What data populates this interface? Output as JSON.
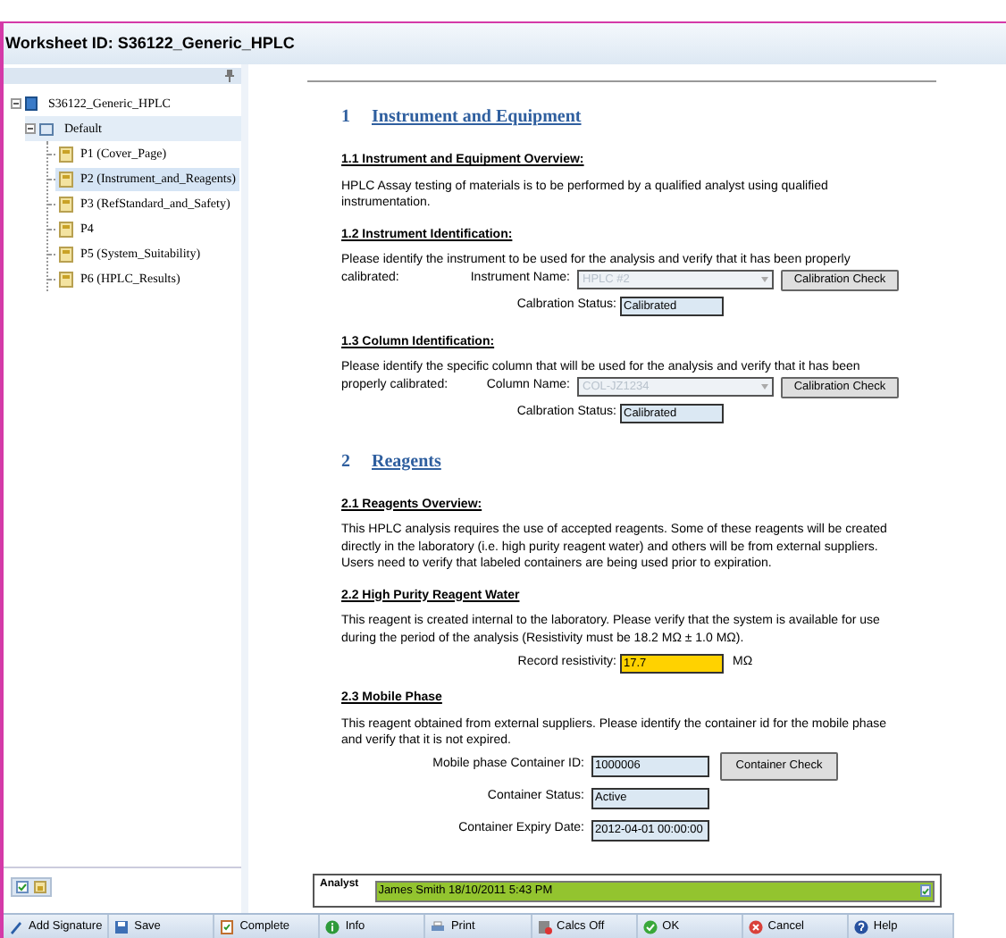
{
  "title": "Worksheet ID: S36122_Generic_HPLC",
  "tree": {
    "label": "S36122_Generic_HPLC",
    "expanded": true,
    "children": [
      {
        "label": "Default",
        "expanded": true,
        "children": [
          {
            "label": "P1 (Cover_Page)",
            "selected": false
          },
          {
            "label": "P2 (Instrument_and_Reagents)",
            "selected": true
          },
          {
            "label": "P3 (RefStandard_and_Safety)",
            "selected": false
          },
          {
            "label": "P4",
            "selected": false
          },
          {
            "label": "P5 (System_Suitability)",
            "selected": false
          },
          {
            "label": "P6 (HPLC_Results)",
            "selected": false
          }
        ]
      }
    ]
  },
  "content": [
    {
      "kind": "heading",
      "number": "1",
      "text": "Instrument and Equipment"
    },
    {
      "kind": "subheading",
      "text": "1.1 Instrument and Equipment Overview:"
    },
    {
      "kind": "paragraph",
      "text": "HPLC Assay testing of materials is to be performed by a qualified analyst using qualified instrumentation."
    },
    {
      "kind": "subheading",
      "text": "1.2 Instrument Identification:"
    },
    {
      "kind": "paragraph",
      "text": "Please identify the instrument to be used for the analysis and verify that it has been properly"
    },
    {
      "kind": "select",
      "lead": "calibrated:",
      "label": "Instrument Name:",
      "value": "HPLC #2",
      "disabled": true,
      "button": "Calibration Check"
    },
    {
      "kind": "field",
      "label": "Calbration Status:",
      "value": "Calibrated",
      "highlight": false
    },
    {
      "kind": "subheading",
      "text": "1.3 Column Identification:"
    },
    {
      "kind": "paragraph",
      "text": "Please identify the specific column that will be used for the analysis and verify that it has been"
    },
    {
      "kind": "select",
      "lead": "properly calibrated:",
      "label": "Column Name:",
      "value": "COL-JZ1234",
      "disabled": true,
      "button": "Calibration Check"
    },
    {
      "kind": "field",
      "label": "Calbration Status:",
      "value": "Calibrated",
      "highlight": false
    },
    {
      "kind": "heading",
      "number": "2",
      "text": "Reagents"
    },
    {
      "kind": "subheading",
      "text": "2.1 Reagents Overview:"
    },
    {
      "kind": "paragraph",
      "text": "This HPLC analysis requires the use of accepted reagents.  Some of these reagents will be created directly in the laboratory (i.e. high purity reagent water) and others will be from external suppliers.  Users need to verify that labeled containers are being used prior to expiration."
    },
    {
      "kind": "subheading",
      "text": "2.2 High Purity Reagent Water"
    },
    {
      "kind": "paragraph",
      "text": "This reagent is created internal to the laboratory.  Please verify that the system is available for use during the period of the analysis (Resistivity must be 18.2 MΩ ± 1.0 MΩ)."
    },
    {
      "kind": "field",
      "label": "Record resistivity:",
      "value": "17.7",
      "highlight": true,
      "unit": "MΩ"
    },
    {
      "kind": "subheading",
      "text": "2.3 Mobile Phase"
    },
    {
      "kind": "paragraph",
      "text": "This reagent obtained from external suppliers.  Please identify the container id for the mobile phase and verify that it is not expired."
    },
    {
      "kind": "wide_field",
      "label": "Mobile phase Container ID:",
      "value": "1000006",
      "button": "Container Check"
    },
    {
      "kind": "wide_field",
      "label": "Container Status:",
      "value": "Active"
    },
    {
      "kind": "wide_field",
      "label": "Container Expiry Date:",
      "value": "2012-04-01 00:00:00"
    }
  ],
  "signature": {
    "role": "Analyst",
    "text": "James Smith 18/10/2011 5:43 PM",
    "signed": true
  },
  "toolbar": [
    {
      "kind": "signature",
      "label": "Add Signature"
    },
    {
      "kind": "save",
      "label": "Save"
    },
    {
      "kind": "complete",
      "label": "Complete"
    },
    {
      "kind": "info",
      "label": "Info"
    },
    {
      "kind": "print",
      "label": "Print"
    },
    {
      "kind": "calcs",
      "label": "Calcs Off"
    },
    {
      "kind": "ok",
      "label": "OK"
    },
    {
      "kind": "cancel",
      "label": "Cancel"
    },
    {
      "kind": "help",
      "label": "Help"
    }
  ]
}
